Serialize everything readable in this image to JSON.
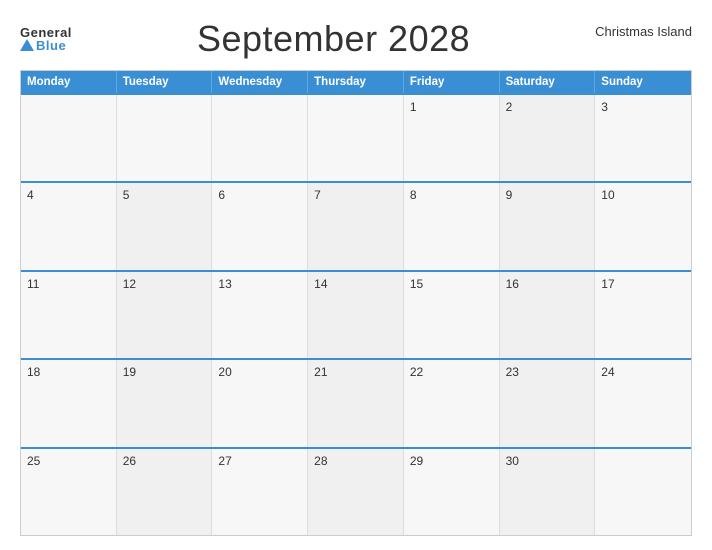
{
  "header": {
    "logo_general": "General",
    "logo_blue": "Blue",
    "title": "September 2028",
    "location": "Christmas Island"
  },
  "calendar": {
    "days": [
      "Monday",
      "Tuesday",
      "Wednesday",
      "Thursday",
      "Friday",
      "Saturday",
      "Sunday"
    ],
    "weeks": [
      [
        {
          "day": "",
          "empty": true
        },
        {
          "day": "",
          "empty": true
        },
        {
          "day": "",
          "empty": true
        },
        {
          "day": "",
          "empty": true
        },
        {
          "day": "1"
        },
        {
          "day": "2"
        },
        {
          "day": "3"
        }
      ],
      [
        {
          "day": "4"
        },
        {
          "day": "5"
        },
        {
          "day": "6"
        },
        {
          "day": "7"
        },
        {
          "day": "8"
        },
        {
          "day": "9"
        },
        {
          "day": "10"
        }
      ],
      [
        {
          "day": "11"
        },
        {
          "day": "12"
        },
        {
          "day": "13"
        },
        {
          "day": "14"
        },
        {
          "day": "15"
        },
        {
          "day": "16"
        },
        {
          "day": "17"
        }
      ],
      [
        {
          "day": "18"
        },
        {
          "day": "19"
        },
        {
          "day": "20"
        },
        {
          "day": "21"
        },
        {
          "day": "22"
        },
        {
          "day": "23"
        },
        {
          "day": "24"
        }
      ],
      [
        {
          "day": "25"
        },
        {
          "day": "26"
        },
        {
          "day": "27"
        },
        {
          "day": "28"
        },
        {
          "day": "29"
        },
        {
          "day": "30"
        },
        {
          "day": ""
        }
      ]
    ]
  }
}
